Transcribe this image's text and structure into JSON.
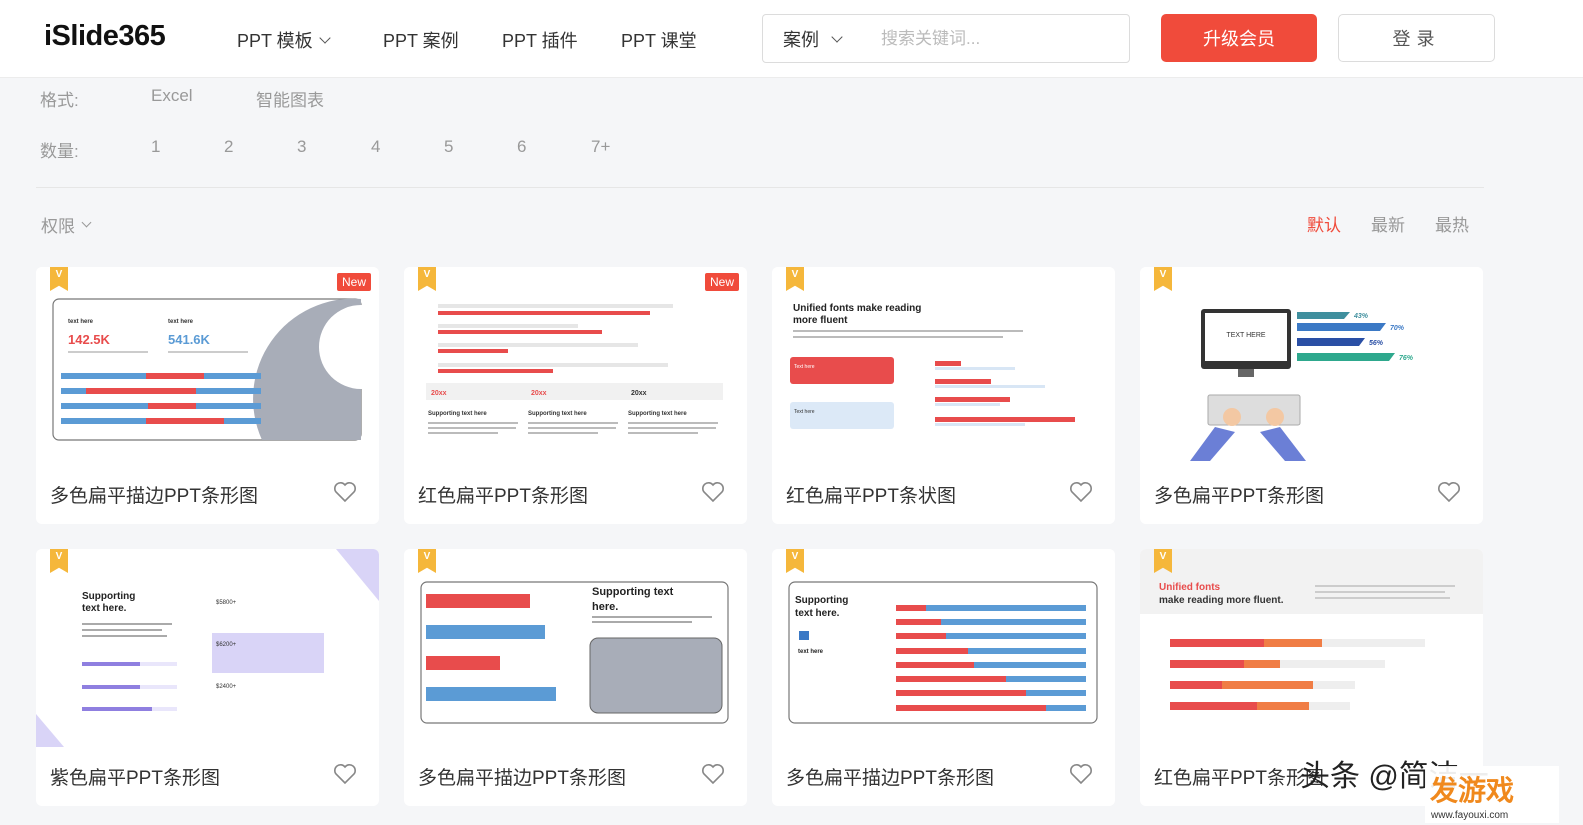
{
  "header": {
    "logo": "iSlide365",
    "nav": [
      {
        "label": "PPT 模板",
        "dropdown": true
      },
      {
        "label": "PPT 案例",
        "dropdown": false
      },
      {
        "label": "PPT 插件",
        "dropdown": false
      },
      {
        "label": "PPT 课堂",
        "dropdown": false
      }
    ],
    "search": {
      "type": "案例",
      "placeholder": "搜索关键词..."
    },
    "upgrade_label": "升级会员",
    "login_label": "登录"
  },
  "filters": {
    "format": {
      "label": "格式:",
      "options": [
        "Excel",
        "智能图表"
      ]
    },
    "count": {
      "label": "数量:",
      "options": [
        "1",
        "2",
        "3",
        "4",
        "5",
        "6",
        "7+"
      ]
    }
  },
  "toolbar": {
    "permission_label": "权限",
    "sort": [
      {
        "label": "默认",
        "active": true
      },
      {
        "label": "最新",
        "active": false
      },
      {
        "label": "最热",
        "active": false
      }
    ]
  },
  "cards": [
    {
      "title": "多色扁平描边PPT条形图",
      "vip": "V",
      "new": "New",
      "thumb": {
        "t1": "text here",
        "t2": "text here",
        "v1": "142.5K",
        "v2": "541.6K"
      }
    },
    {
      "title": "红色扁平PPT条形图",
      "vip": "V",
      "new": "New",
      "thumb": {
        "c1": "20xx",
        "c2": "20xx",
        "c3": "20xx",
        "s1": "Supporting text here",
        "s2": "Supporting text here",
        "s3": "Supporting text here"
      }
    },
    {
      "title": "红色扁平PPT条状图",
      "vip": "V",
      "thumb": {
        "h1": "Unified fonts make reading",
        "h2": "more fluent",
        "b1": "Text here",
        "b2": "Text here"
      }
    },
    {
      "title": "多色扁平PPT条形图",
      "vip": "V",
      "thumb": {
        "screen": "TEXT HERE",
        "p1": "43%",
        "p2": "70%",
        "p3": "56%",
        "p4": "76%"
      }
    },
    {
      "title": "紫色扁平PPT条形图",
      "vip": "V",
      "thumb": {
        "h1": "Supporting",
        "h2": "text here.",
        "m1": "$5800+",
        "m2": "$6200+",
        "m3": "$2400+"
      }
    },
    {
      "title": "多色扁平描边PPT条形图",
      "vip": "V",
      "thumb": {
        "h1": "Supporting text",
        "h2": "here."
      }
    },
    {
      "title": "多色扁平描边PPT条形图",
      "vip": "V",
      "thumb": {
        "h1": "Supporting",
        "h2": "text here.",
        "t": "text here"
      }
    },
    {
      "title": "红色扁平PPT条形图",
      "vip": "V",
      "thumb": {
        "h1": "Unified fonts",
        "h2": "make reading more fluent."
      }
    }
  ],
  "watermark": {
    "line1": "头条 @简洁一",
    "brand": "发游戏",
    "url": "www.fayouxi.com"
  },
  "colors": {
    "accent": "#f04b3b",
    "vip": "#f5b73b",
    "blue": "#5b9bd5",
    "red": "#e84c4c",
    "purple": "#8f7fe0"
  }
}
